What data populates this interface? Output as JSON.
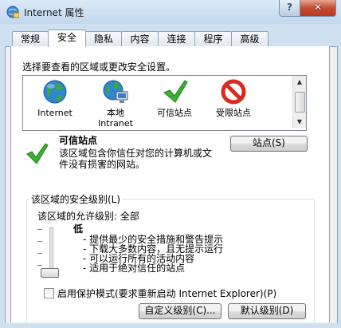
{
  "window": {
    "title": "Internet 属性",
    "help_label": "?",
    "close_label": "✕"
  },
  "tabs": [
    {
      "label": "常规"
    },
    {
      "label": "安全"
    },
    {
      "label": "隐私"
    },
    {
      "label": "内容"
    },
    {
      "label": "连接"
    },
    {
      "label": "程序"
    },
    {
      "label": "高级"
    }
  ],
  "security": {
    "zone_prompt": "选择要查看的区域或更改安全设置。",
    "zones": [
      {
        "label": "Internet",
        "icon": "globe-icon"
      },
      {
        "label": "本地\nIntranet",
        "icon": "intranet-icon"
      },
      {
        "label": "可信站点",
        "icon": "checkmark-icon"
      },
      {
        "label": "受限站点",
        "icon": "prohibited-icon"
      }
    ],
    "selected_zone": {
      "title": "可信站点",
      "description": "该区域包含你信任对您的计算机或文件没有损害的网站。",
      "sites_button": "站点(S)"
    },
    "level": {
      "group_label": "该区域的安全级别(L)",
      "allowed_levels": "该区域的允许级别: 全部",
      "name": "低",
      "bullets": [
        "提供最少的安全措施和警告提示",
        "下载大多数内容，且无提示运行",
        "可以运行所有的活动内容",
        "适用于绝对信任的站点"
      ]
    },
    "protected_mode_label": "启用保护模式(要求重新启动 Internet Explorer)(P)",
    "custom_level_button": "自定义级别(C)...",
    "default_level_button": "默认级别(D)"
  },
  "colors": {
    "accent_check": "#2fa52a",
    "prohibited_red": "#d62b1f"
  }
}
